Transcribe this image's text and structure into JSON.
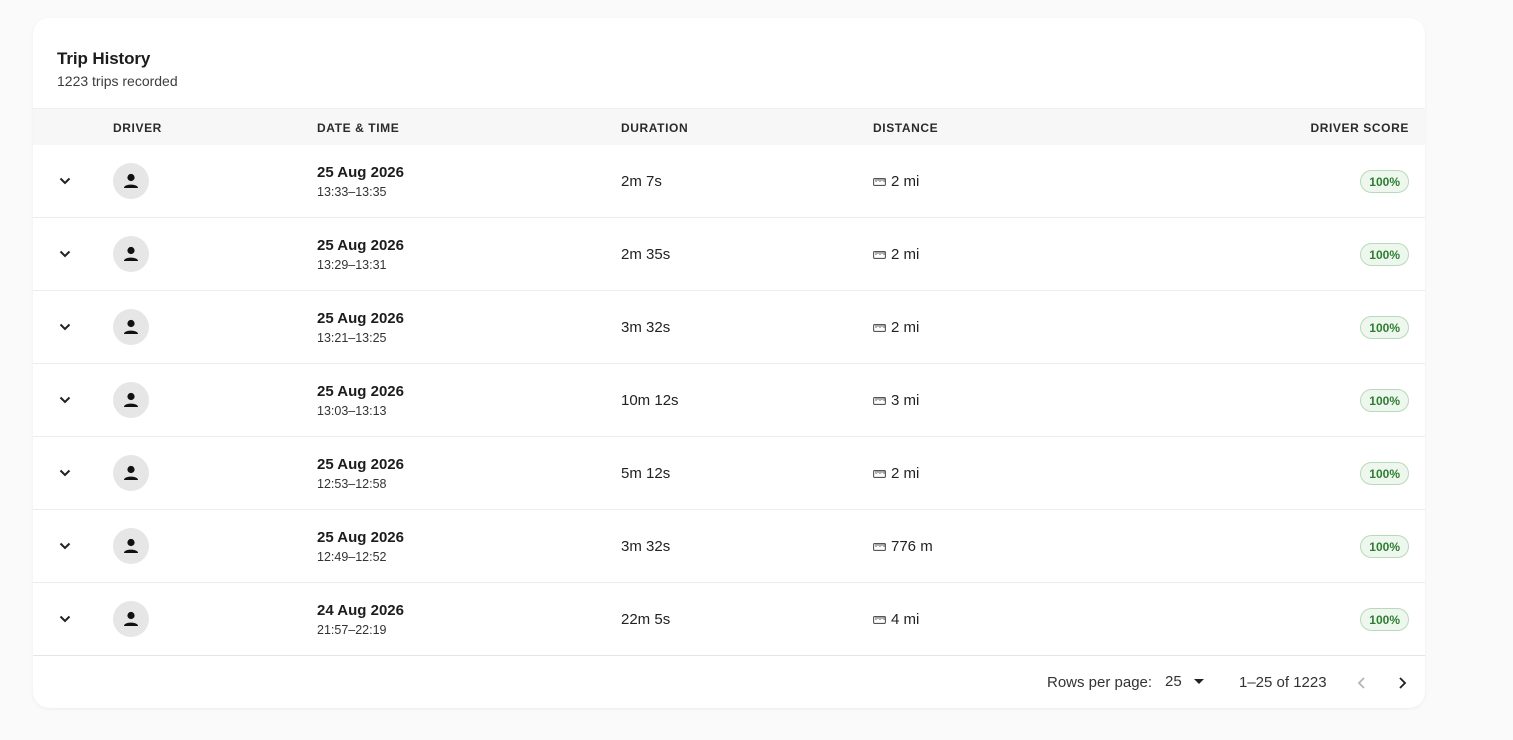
{
  "card": {
    "title": "Trip History",
    "subtitle": "1223 trips recorded"
  },
  "columns": {
    "driver": "DRIVER",
    "datetime": "DATE & TIME",
    "duration": "DURATION",
    "distance": "DISTANCE",
    "score": "DRIVER SCORE"
  },
  "rows": [
    {
      "date": "25 Aug 2026",
      "time": "13:33–13:35",
      "duration": "2m 7s",
      "distance": "2 mi",
      "score": "100%"
    },
    {
      "date": "25 Aug 2026",
      "time": "13:29–13:31",
      "duration": "2m 35s",
      "distance": "2 mi",
      "score": "100%"
    },
    {
      "date": "25 Aug 2026",
      "time": "13:21–13:25",
      "duration": "3m 32s",
      "distance": "2 mi",
      "score": "100%"
    },
    {
      "date": "25 Aug 2026",
      "time": "13:03–13:13",
      "duration": "10m 12s",
      "distance": "3 mi",
      "score": "100%"
    },
    {
      "date": "25 Aug 2026",
      "time": "12:53–12:58",
      "duration": "5m 12s",
      "distance": "2 mi",
      "score": "100%"
    },
    {
      "date": "25 Aug 2026",
      "time": "12:49–12:52",
      "duration": "3m 32s",
      "distance": "776 m",
      "score": "100%"
    },
    {
      "date": "24 Aug 2026",
      "time": "21:57–22:19",
      "duration": "22m 5s",
      "distance": "4 mi",
      "score": "100%"
    }
  ],
  "pagination": {
    "rows_per_page_label": "Rows per page:",
    "rows_per_page_value": "25",
    "range": "1–25 of 1223"
  },
  "icons": {
    "expand": "chevron-down-icon",
    "avatar": "person-icon",
    "distance": "ruler-icon",
    "prev": "chevron-left-icon",
    "next": "chevron-right-icon"
  },
  "colors": {
    "score_text": "#2e7d32",
    "score_bg": "#eef7ee",
    "score_border": "#b9d9bb"
  }
}
